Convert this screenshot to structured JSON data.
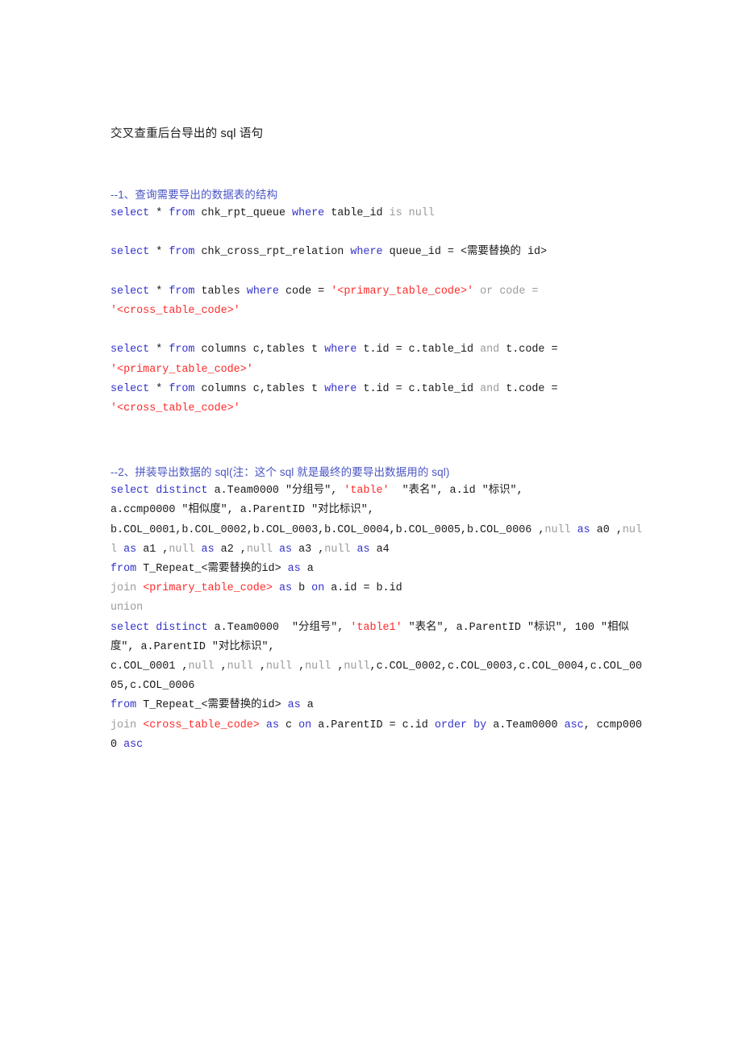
{
  "document": {
    "title": "交叉查重后台导出的 sql 语句",
    "page_background": "#ffffff",
    "colors": {
      "keyword": "#3333cc",
      "keyword_secondary": "#9b9b9b",
      "string_literal": "#ff2a2a",
      "heading": "#4a55c4",
      "plain_text": "#1a1a1a"
    }
  },
  "sections": [
    {
      "heading": "--1、查询需要导出的数据表的结构",
      "statements": [
        "select * from chk_rpt_queue where table_id is null",
        "select * from chk_cross_rpt_relation where queue_id = <需要替换的 id>",
        "select * from tables where code = '<primary_table_code>' or code = '<cross_table_code>'",
        "select * from columns c,tables t where t.id = c.table_id and t.code = '<primary_table_code>'",
        "select * from columns c,tables t where t.id = c.table_id and t.code = '<cross_table_code>'"
      ]
    },
    {
      "heading": "--2、拼装导出数据的 sql(注：这个 sql 就是最终的要导出数据用的 sql)",
      "statements": [
        "select distinct a.Team0000 \"分组号\", 'table'  \"表名\", a.id \"标识\", a.ccmp0000 \"相似度\", a.ParentID \"对比标识\",",
        "b.COL_0001,b.COL_0002,b.COL_0003,b.COL_0004,b.COL_0005,b.COL_0006 ,null as a0 ,null as a1 ,null as a2 ,null as a3 ,null as a4",
        "from T_Repeat_<需要替换的id> as a",
        "join <primary_table_code> as b on a.id = b.id",
        "union",
        "select distinct a.Team0000  \"分组号\", 'table1' \"表名\", a.ParentID \"标识\", 100 \"相似度\", a.ParentID \"对比标识\",",
        "c.COL_0001 ,null ,null ,null ,null ,null,c.COL_0002,c.COL_0003,c.COL_0004,c.COL_0005,c.COL_0006",
        "from T_Repeat_<需要替换的id> as a",
        "join <cross_table_code> as c on a.ParentID = c.id order by a.Team0000 asc, ccmp0000 asc"
      ]
    }
  ],
  "code_blocks": {
    "block1_line1": {
      "kw_select": "select",
      "star": " * ",
      "kw_from": "from",
      "tbl": " chk_rpt_queue ",
      "kw_where": "where",
      "col": " table_id ",
      "kw2_isnull": "is null"
    },
    "block1_line2": {
      "kw_select": "select",
      "star": " * ",
      "kw_from": "from",
      "tbl": " chk_cross_rpt_relation ",
      "kw_where": "where",
      "col": " queue_id = <需要替换的 id>"
    },
    "block1_line3a": {
      "kw_select": "select",
      "star": " * ",
      "kw_from": "from",
      "tbl": " tables ",
      "kw_where": "where",
      "col": " code = ",
      "str1": "'<primary_table_code>'",
      "kw2_or": " or ",
      "col2": "code = "
    },
    "block1_line3b": {
      "str": "'<cross_table_code>'"
    },
    "block1_line4a": {
      "kw_select": "select",
      "star": " * ",
      "kw_from": "from",
      "tbl": " columns c,tables t ",
      "kw_where": "where",
      "col": " t.id = c.table_id ",
      "kw2_and": "and",
      "col2": " t.code = "
    },
    "block1_line4b": {
      "str": "'<primary_table_code>'"
    },
    "block1_line5a": {
      "kw_select": "select",
      "star": " * ",
      "kw_from": "from",
      "tbl": " columns c,tables t ",
      "kw_where": "where",
      "col": " t.id = c.table_id ",
      "kw2_and": "and",
      "col2": " t.code = "
    },
    "block1_line5b": {
      "str": "'<cross_table_code>'"
    },
    "block2_line1": {
      "kw_select": "select",
      "sp": " ",
      "kw_distinct": "distinct",
      "p1": " a.Team0000 \"分组号\", ",
      "str": "'table'",
      "p2": "  \"表名\", a.id \"标识\","
    },
    "block2_line2": {
      "text": "a.ccmp0000 \"相似度\", a.ParentID \"对比标识\","
    },
    "block2_line3": {
      "cols": "b.COL_0001,b.COL_0002,b.COL_0003,b.COL_0004,b.COL_0005,b.COL_0006 ,",
      "null1": "null",
      "as1": " as ",
      "a0": "a0 ,",
      "null2": "null",
      "as2": " as ",
      "a1": "a1 ,",
      "null3": "null",
      "as3": " as ",
      "a2": "a2 ,",
      "null4": "null",
      "as4": " as ",
      "a3": "a3 ,",
      "null5": "null",
      "as5": " as ",
      "a4": "a4"
    },
    "block2_line4": {
      "kw_from": "from",
      "tbl": " T_Repeat_<需要替换的id> ",
      "kw_as": "as",
      "alias": " a"
    },
    "block2_line5": {
      "kw2_join": "join",
      "sp": " ",
      "str": "<primary_table_code>",
      "sp2": " ",
      "kw_as": "as",
      "b": " b ",
      "kw_on": "on",
      "cond": " a.id = b.id"
    },
    "block2_line6": {
      "kw2_union": "union"
    },
    "block2_line7": {
      "kw_select": "select",
      "sp": " ",
      "kw_distinct": "distinct",
      "p1": " a.Team0000  \"分组号\", ",
      "str": "'table1'",
      "p2": " \"表名\", a.ParentID \"标识\", 100 \"相似度\", a.ParentID \"对比标识\","
    },
    "block2_line8": {
      "c1": "c.COL_0001 ,",
      "n1": "null",
      "s1": " ,",
      "n2": "null",
      "s2": " ,",
      "n3": "null",
      "s3": " ,",
      "n4": "null",
      "s4": " ,",
      "n5": "null",
      "s5": ",c.COL_0002,c.COL_0003,c.COL_0004,c.COL_0005,c.COL_0006"
    },
    "block2_line9": {
      "kw_from": "from",
      "tbl": " T_Repeat_<需要替换的id> ",
      "kw_as": "as",
      "alias": " a"
    },
    "block2_line10": {
      "kw2_join": "join",
      "sp": " ",
      "str": "<cross_table_code>",
      "sp2": " ",
      "kw_as": "as",
      "c": " c ",
      "kw_on": "on",
      "cond": " a.ParentID = c.id ",
      "kw_orderby": "order by",
      "col": " a.Team0000 ",
      "kw_asc1": "asc",
      "comma": ", ccmp0000 ",
      "kw_asc2": "asc"
    }
  }
}
